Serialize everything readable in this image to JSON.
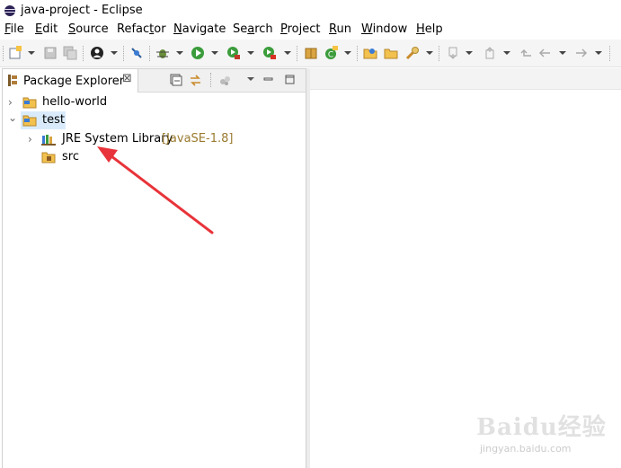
{
  "window": {
    "title": "java-project - Eclipse"
  },
  "menu": [
    {
      "label": "File",
      "mnemonic": "F",
      "rest": "ile"
    },
    {
      "label": "Edit",
      "mnemonic": "E",
      "rest": "dit"
    },
    {
      "label": "Source",
      "mnemonic": "S",
      "rest": "ource"
    },
    {
      "label": "Refactor",
      "pre": "Refac",
      "mnemonic": "t",
      "rest": "or"
    },
    {
      "label": "Navigate",
      "mnemonic": "N",
      "rest": "avigate"
    },
    {
      "label": "Search",
      "pre": "Se",
      "mnemonic": "a",
      "rest": "rch"
    },
    {
      "label": "Project",
      "mnemonic": "P",
      "rest": "roject"
    },
    {
      "label": "Run",
      "mnemonic": "R",
      "rest": "un"
    },
    {
      "label": "Window",
      "mnemonic": "W",
      "rest": "indow"
    },
    {
      "label": "Help",
      "mnemonic": "H",
      "rest": "elp"
    }
  ],
  "explorer": {
    "tab_label": "Package Explorer",
    "close_glyph": "⊠",
    "tree": [
      {
        "label": "hello-world",
        "twisty": "›",
        "icon": "project-folder-icon",
        "decoration": ""
      },
      {
        "label": "test",
        "twisty": "⌄",
        "icon": "project-folder-icon",
        "decoration": "",
        "selected": true
      },
      {
        "label": "JRE System Library",
        "twisty": "›",
        "icon": "library-icon",
        "decoration": "[JavaSE-1.8]"
      },
      {
        "label": "src",
        "twisty": "",
        "icon": "source-folder-icon",
        "decoration": ""
      }
    ]
  },
  "watermark": {
    "main": "Baidu经验",
    "sub": "jingyan.baidu.com"
  },
  "colors": {
    "selection": "#d9ebfb",
    "annotation_arrow": "#e8333a",
    "decoration": "#9a7b2f"
  }
}
